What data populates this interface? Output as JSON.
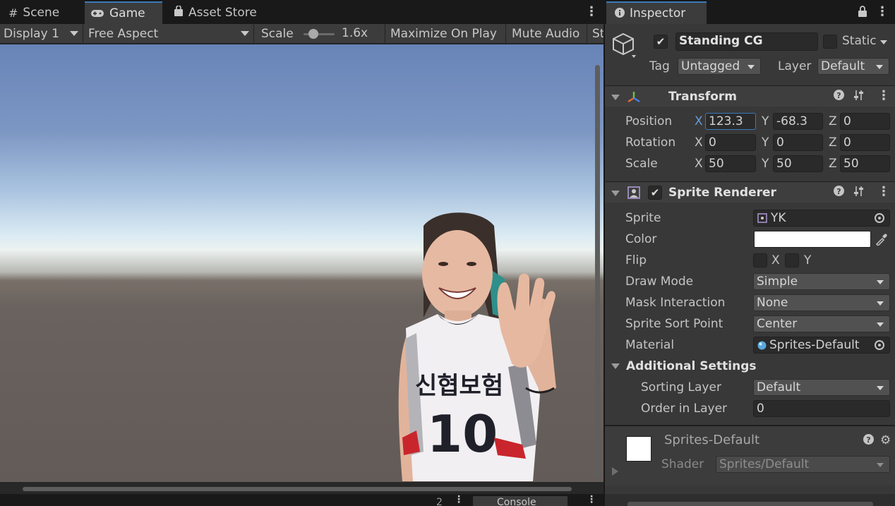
{
  "game_panel": {
    "tabs": [
      {
        "icon": "#",
        "label": "Scene"
      },
      {
        "icon": "gamepad-icon",
        "label": "Game"
      },
      {
        "icon": "store-bag-icon",
        "label": "Asset Store"
      }
    ],
    "toolbar": {
      "display": "Display 1",
      "aspect": "Free Aspect",
      "scale_label": "Scale",
      "scale_value": "1.6x",
      "maximize": "Maximize On Play",
      "mute": "Mute Audio",
      "stats": "St"
    },
    "sprite": {
      "jersey_text": "신협보험",
      "jersey_number": "10"
    },
    "bottom": {
      "count": "2",
      "console_label": "Console"
    }
  },
  "inspector": {
    "tab_label": "Inspector",
    "object": {
      "name": "Standing CG",
      "active": true,
      "static_label": "Static",
      "tag_label": "Tag",
      "tag_value": "Untagged",
      "layer_label": "Layer",
      "layer_value": "Default"
    },
    "transform": {
      "title": "Transform",
      "rows": [
        {
          "label": "Position",
          "x": "123.3",
          "y": "-68.3",
          "z": "0"
        },
        {
          "label": "Rotation",
          "x": "0",
          "y": "0",
          "z": "0"
        },
        {
          "label": "Scale",
          "x": "50",
          "y": "50",
          "z": "50"
        }
      ],
      "axis": {
        "x": "X",
        "y": "Y",
        "z": "Z"
      }
    },
    "sprite_renderer": {
      "title": "Sprite Renderer",
      "enabled": true,
      "sprite_label": "Sprite",
      "sprite_value": "YK",
      "color_label": "Color",
      "color_value": "#ffffff",
      "flip_label": "Flip",
      "flip_x": "X",
      "flip_y": "Y",
      "draw_mode_label": "Draw Mode",
      "draw_mode_value": "Simple",
      "mask_label": "Mask Interaction",
      "mask_value": "None",
      "sort_point_label": "Sprite Sort Point",
      "sort_point_value": "Center",
      "material_label": "Material",
      "material_value": "Sprites-Default",
      "additional_title": "Additional Settings",
      "sorting_layer_label": "Sorting Layer",
      "sorting_layer_value": "Default",
      "order_label": "Order in Layer",
      "order_value": "0"
    },
    "material_preview": {
      "name": "Sprites-Default",
      "shader_label": "Shader",
      "shader_value": "Sprites/Default"
    }
  }
}
